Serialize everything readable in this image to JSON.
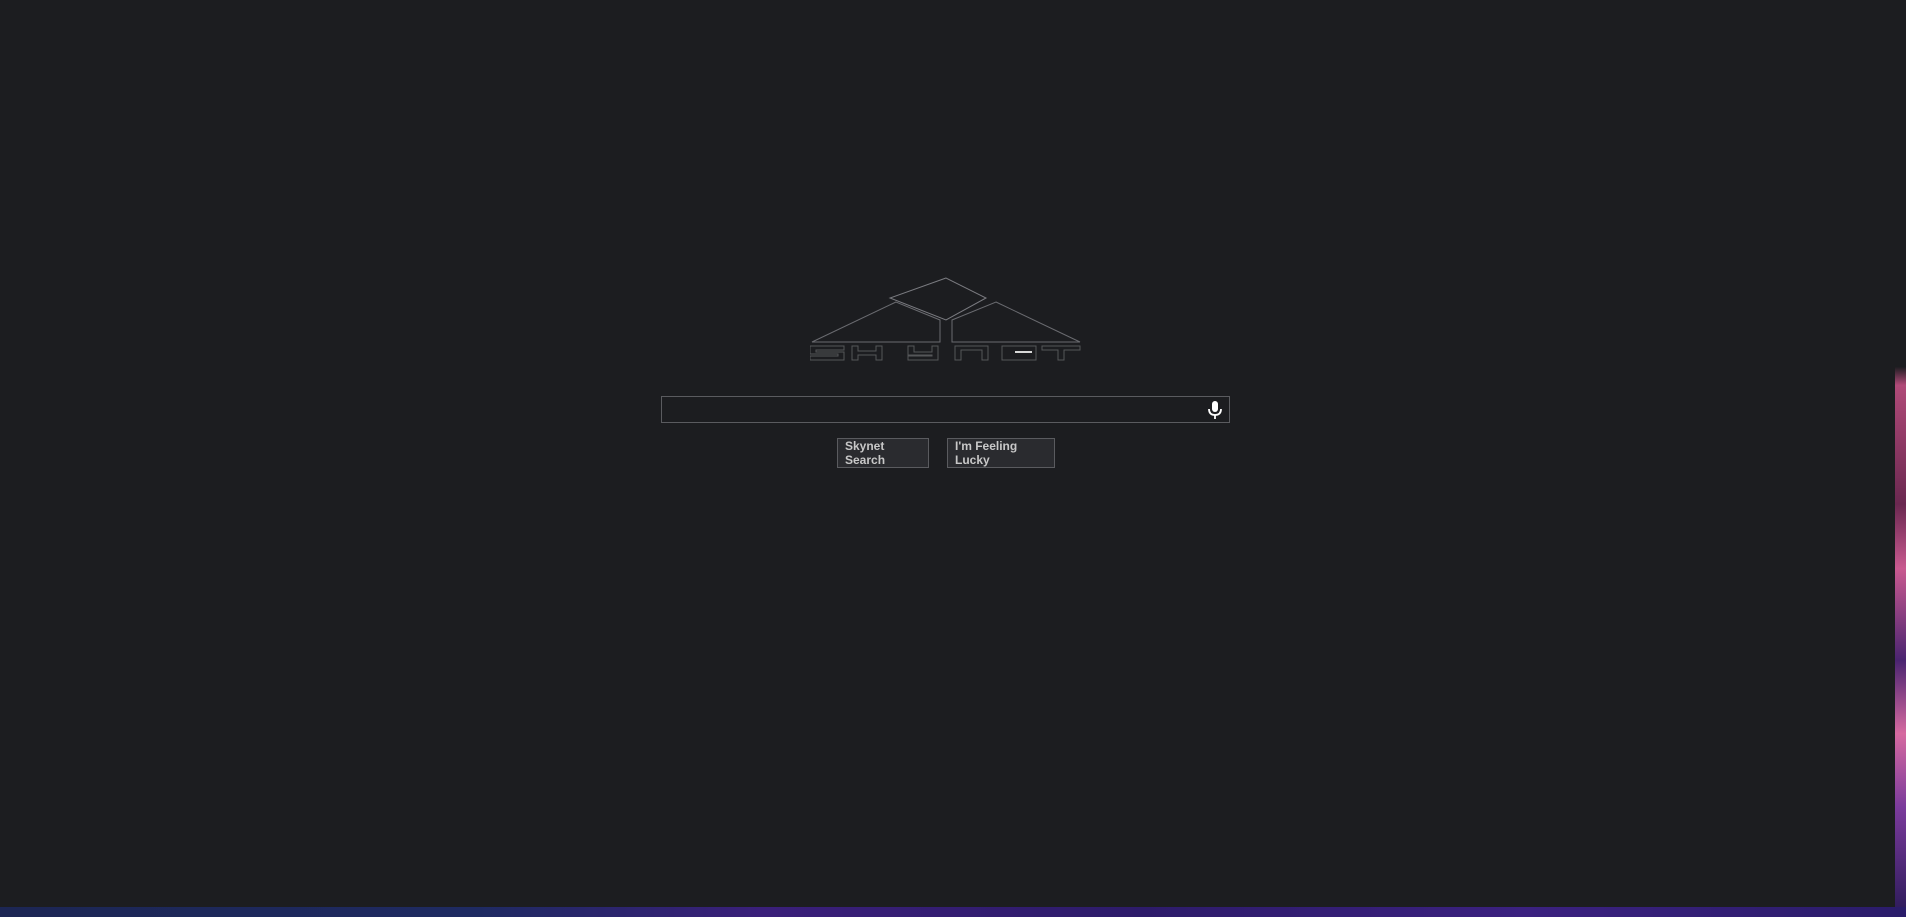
{
  "logo": {
    "icon": "skynet-logo"
  },
  "search": {
    "value": "",
    "placeholder": "",
    "mic_icon": "microphone-icon"
  },
  "buttons": {
    "search_label": "Skynet Search",
    "lucky_label": "I'm Feeling Lucky"
  },
  "colors": {
    "background": "#1c1d20",
    "border": "#5a5b5f",
    "button_bg": "#2a2b2f",
    "button_text": "#c8c8c8"
  }
}
